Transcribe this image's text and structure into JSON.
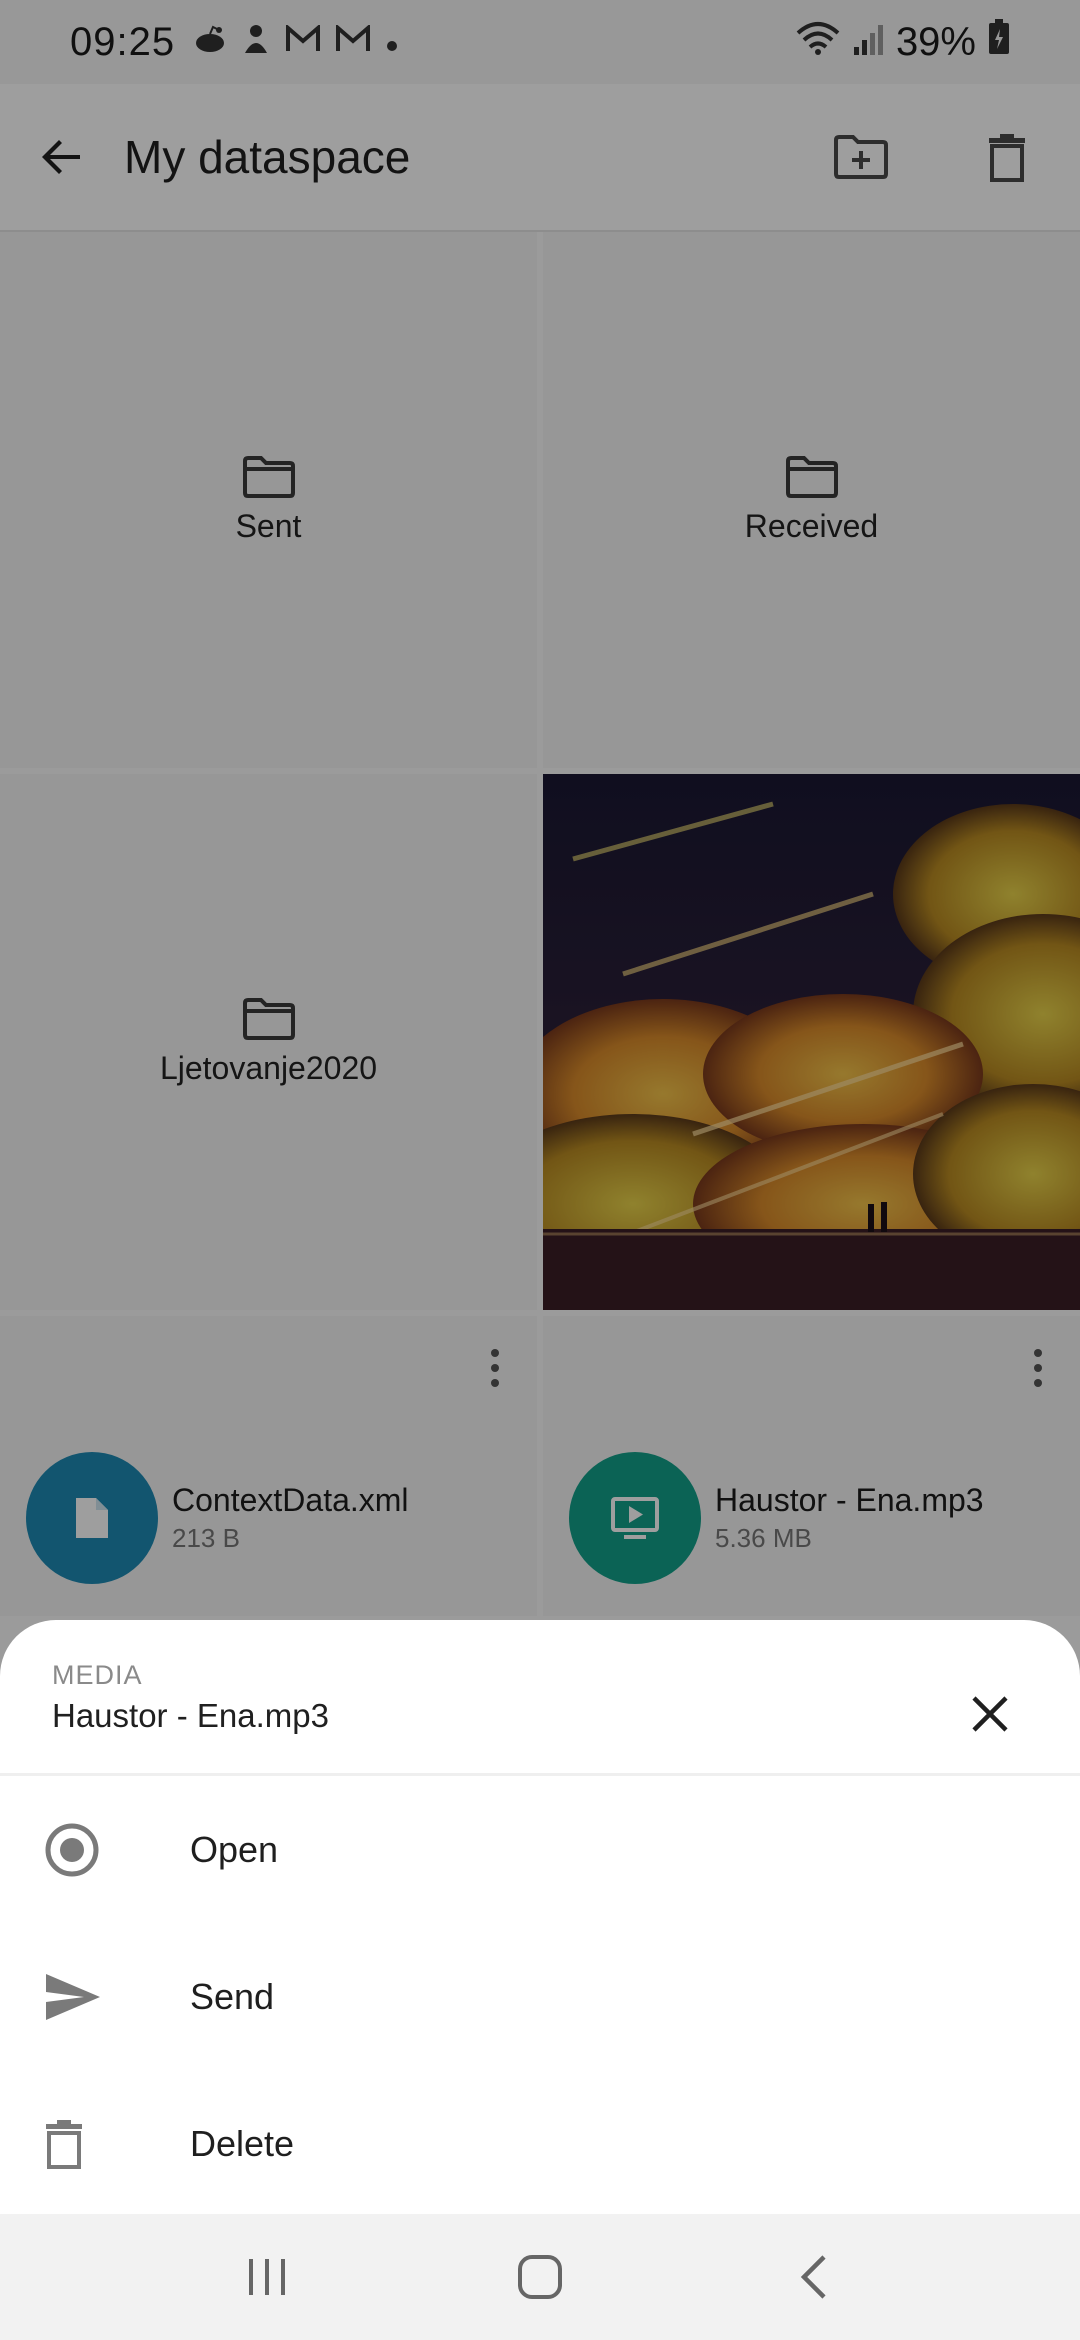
{
  "status_bar": {
    "time": "09:25",
    "battery": "39%",
    "notification_icons": [
      "reddit-icon",
      "app-icon",
      "gmail-icon",
      "gmail-icon",
      "dot-icon"
    ]
  },
  "app_bar": {
    "title": "My dataspace"
  },
  "grid": {
    "folders": [
      {
        "label": "Sent"
      },
      {
        "label": "Received"
      },
      {
        "label": "Ljetovanje2020"
      }
    ],
    "files": [
      {
        "name": "ContextData.xml",
        "size": "213 B",
        "icon": "document-icon",
        "color": "#1e8ab3"
      },
      {
        "name": "Haustor - Ena.mp3",
        "size": "5.36 MB",
        "icon": "media-icon",
        "color": "#12a08a"
      }
    ]
  },
  "sheet": {
    "category": "MEDIA",
    "name": "Haustor - Ena.mp3",
    "items": [
      {
        "label": "Open",
        "icon": "open-icon"
      },
      {
        "label": "Send",
        "icon": "send-icon"
      },
      {
        "label": "Delete",
        "icon": "delete-icon"
      }
    ]
  },
  "colors": {
    "scrim": "#000000",
    "file_blue": "#1e8ab3",
    "file_green": "#12a08a"
  }
}
